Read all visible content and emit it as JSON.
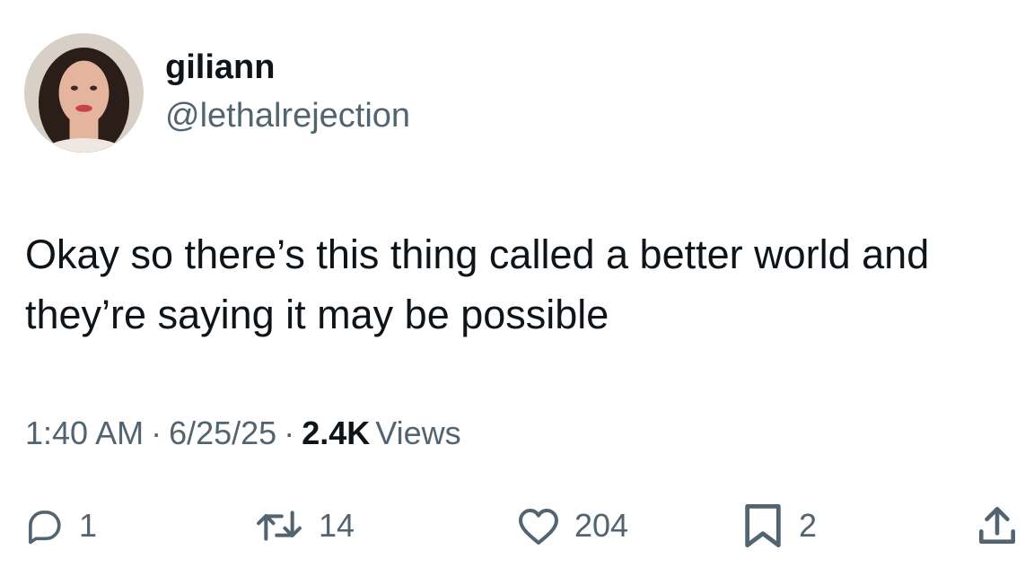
{
  "user": {
    "display_name": "giliann",
    "handle": "@lethalrejection"
  },
  "tweet": {
    "text": "Okay so there’s this thing called a better world and they’re saying it may be possible",
    "time": "1:40 AM",
    "date": "6/25/25",
    "separator": "·",
    "views_count": "2.4K",
    "views_label": "Views"
  },
  "actions": {
    "replies": "1",
    "retweets": "14",
    "likes": "204",
    "bookmarks": "2"
  },
  "icons": {
    "reply": "reply-icon",
    "retweet": "retweet-icon",
    "like": "heart-icon",
    "bookmark": "bookmark-icon",
    "share": "share-icon"
  },
  "colors": {
    "primary_text": "#0f1419",
    "secondary_text": "#536471",
    "background": "#ffffff"
  }
}
